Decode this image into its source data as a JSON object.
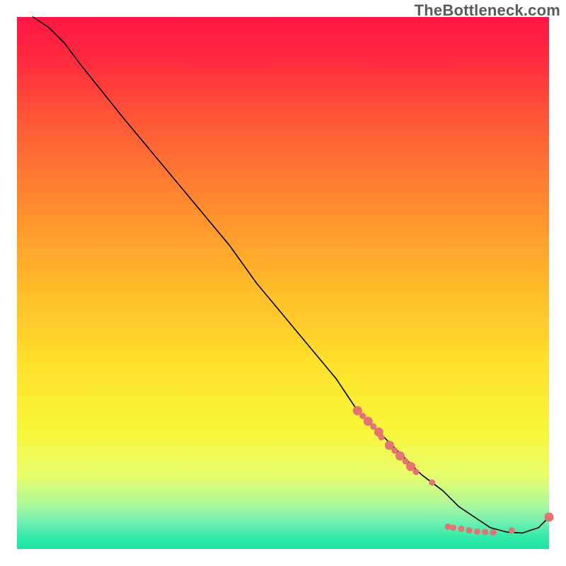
{
  "watermark": "TheBottleneck.com",
  "chart_data": {
    "type": "line",
    "title": "",
    "xlabel": "",
    "ylabel": "",
    "xlim": [
      0,
      100
    ],
    "ylim": [
      0,
      100
    ],
    "grid": false,
    "legend": false,
    "gradient_stops": [
      {
        "offset": 0.0,
        "color": "#ff1744"
      },
      {
        "offset": 0.08,
        "color": "#ff2a3f"
      },
      {
        "offset": 0.2,
        "color": "#ff5a36"
      },
      {
        "offset": 0.35,
        "color": "#ff8a2e"
      },
      {
        "offset": 0.5,
        "color": "#ffb92a"
      },
      {
        "offset": 0.65,
        "color": "#ffe02a"
      },
      {
        "offset": 0.78,
        "color": "#f7f73a"
      },
      {
        "offset": 0.86,
        "color": "#e8fd6a"
      },
      {
        "offset": 0.91,
        "color": "#b7fa95"
      },
      {
        "offset": 0.95,
        "color": "#6df0b2"
      },
      {
        "offset": 0.98,
        "color": "#2fe8a8"
      },
      {
        "offset": 1.0,
        "color": "#1fe3a2"
      }
    ],
    "series": [
      {
        "name": "bottleneck-curve",
        "color": "#000000",
        "x": [
          3,
          6,
          9,
          12,
          16,
          20,
          25,
          30,
          35,
          40,
          45,
          50,
          55,
          60,
          64,
          68,
          72,
          76,
          80,
          83,
          86,
          89,
          92,
          95,
          98,
          100
        ],
        "y": [
          100,
          98,
          95,
          91,
          86,
          81,
          75,
          69,
          63,
          57,
          50,
          44,
          38,
          32,
          26,
          22,
          18,
          14,
          11,
          8,
          6,
          4,
          3.2,
          3,
          4,
          6
        ]
      }
    ],
    "markers": {
      "name": "highlight-points",
      "color": "#e57373",
      "radius_small": 4.5,
      "radius_large": 6.5,
      "points": [
        {
          "x": 64,
          "y": 26,
          "r": "large"
        },
        {
          "x": 65,
          "y": 25,
          "r": "small"
        },
        {
          "x": 66,
          "y": 24,
          "r": "large"
        },
        {
          "x": 67,
          "y": 23,
          "r": "small"
        },
        {
          "x": 68,
          "y": 22,
          "r": "large"
        },
        {
          "x": 68.5,
          "y": 21,
          "r": "small"
        },
        {
          "x": 70,
          "y": 19.5,
          "r": "large"
        },
        {
          "x": 71,
          "y": 18.5,
          "r": "small"
        },
        {
          "x": 72,
          "y": 17.5,
          "r": "large"
        },
        {
          "x": 73,
          "y": 16.5,
          "r": "small"
        },
        {
          "x": 74,
          "y": 15.5,
          "r": "large"
        },
        {
          "x": 75,
          "y": 14.5,
          "r": "small"
        },
        {
          "x": 78,
          "y": 12.5,
          "r": "small"
        },
        {
          "x": 81,
          "y": 4.2,
          "r": "small"
        },
        {
          "x": 82,
          "y": 4.0,
          "r": "small"
        },
        {
          "x": 83.5,
          "y": 3.8,
          "r": "small"
        },
        {
          "x": 85,
          "y": 3.5,
          "r": "small"
        },
        {
          "x": 86.5,
          "y": 3.3,
          "r": "small"
        },
        {
          "x": 88,
          "y": 3.2,
          "r": "small"
        },
        {
          "x": 89.5,
          "y": 3.1,
          "r": "small"
        },
        {
          "x": 93,
          "y": 3.5,
          "r": "small"
        },
        {
          "x": 100,
          "y": 6.0,
          "r": "large"
        }
      ]
    }
  }
}
